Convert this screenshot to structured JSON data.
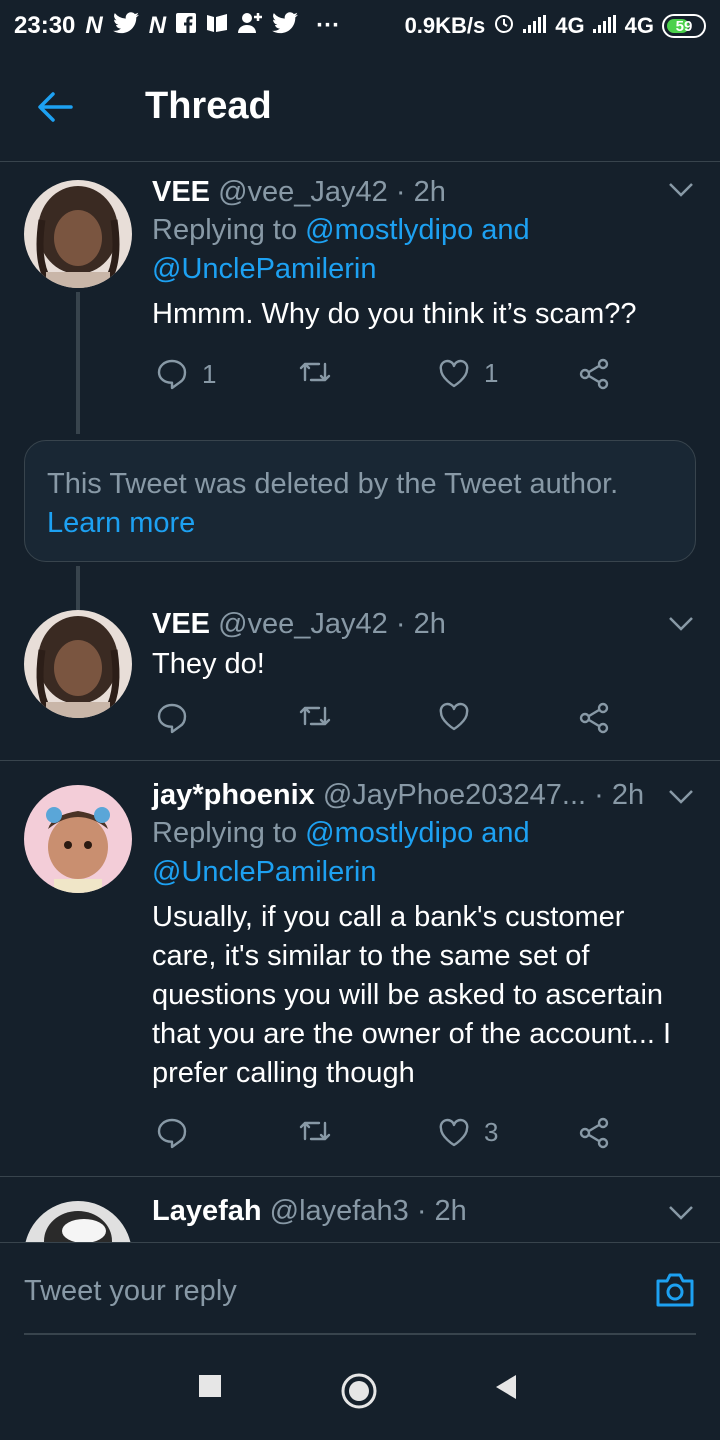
{
  "status_bar": {
    "time": "23:30",
    "left_icons": [
      "N",
      "bird-icon",
      "N",
      "facebook-icon",
      "app-icon",
      "add-user-icon",
      "bird-icon"
    ],
    "more": "···",
    "speed": "0.9KB/s",
    "network1": "4G",
    "network2": "4G",
    "battery": "59"
  },
  "header": {
    "title": "Thread"
  },
  "tweets": [
    {
      "name": "VEE",
      "handle": "@vee_Jay42",
      "time": "· 2h",
      "replying_prefix": "Replying to",
      "reply_mention1": "@mostlydipo",
      "reply_and": "and",
      "reply_mention2": "@UnclePamilerin",
      "text": "Hmmm. Why do you think it’s scam??",
      "replies": "1",
      "retweets": "",
      "likes": "1"
    },
    {
      "name": "VEE",
      "handle": "@vee_Jay42",
      "time": "· 2h",
      "text": "They do!",
      "replies": "",
      "retweets": "",
      "likes": ""
    },
    {
      "name": "jay*phoenix",
      "handle": "@JayPhoe203247...",
      "time": "· 2h",
      "replying_prefix": "Replying to",
      "reply_mention1": "@mostlydipo",
      "reply_and": "and",
      "reply_mention2": "@UnclePamilerin",
      "text": "Usually, if you call a bank's customer care, it's similar to the same set of questions you will be asked to ascertain that you are the owner of the account... I prefer calling though",
      "replies": "",
      "retweets": "",
      "likes": "3"
    },
    {
      "name": "Layefah",
      "handle": "@layefah3",
      "time": "· 2h"
    }
  ],
  "deleted": {
    "text": "This Tweet was deleted by the Tweet author.",
    "learn_more": "Learn more"
  },
  "reply_bar": {
    "placeholder": "Tweet your reply"
  },
  "colors": {
    "background": "#15202b",
    "accent": "#1da1f2",
    "muted": "#8899a6",
    "border": "#38444d"
  }
}
